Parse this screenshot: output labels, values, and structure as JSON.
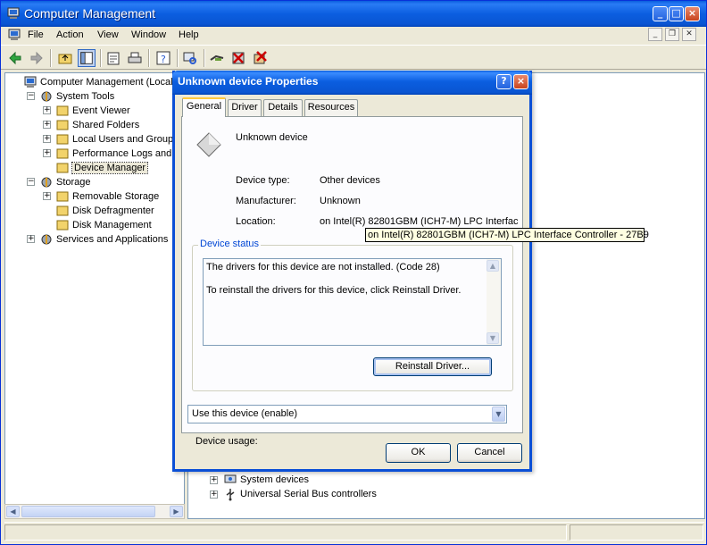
{
  "window": {
    "title": "Computer Management"
  },
  "menu": [
    "File",
    "Action",
    "View",
    "Window",
    "Help"
  ],
  "tree": {
    "items": [
      {
        "label": "Computer Management (Local)",
        "level": 0,
        "expander": ""
      },
      {
        "label": "System Tools",
        "level": 1,
        "expander": "-"
      },
      {
        "label": "Event Viewer",
        "level": 2,
        "expander": "+"
      },
      {
        "label": "Shared Folders",
        "level": 2,
        "expander": "+"
      },
      {
        "label": "Local Users and Groups",
        "level": 2,
        "expander": "+"
      },
      {
        "label": "Performance Logs and Alerts",
        "level": 2,
        "expander": "+"
      },
      {
        "label": "Device Manager",
        "level": 2,
        "expander": ""
      },
      {
        "label": "Storage",
        "level": 1,
        "expander": "-"
      },
      {
        "label": "Removable Storage",
        "level": 2,
        "expander": "+"
      },
      {
        "label": "Disk Defragmenter",
        "level": 2,
        "expander": ""
      },
      {
        "label": "Disk Management",
        "level": 2,
        "expander": ""
      },
      {
        "label": "Services and Applications",
        "level": 1,
        "expander": "+"
      }
    ]
  },
  "devices": [
    "System devices",
    "Universal Serial Bus controllers"
  ],
  "dialog": {
    "title": "Unknown device Properties",
    "tabs": [
      "General",
      "Driver",
      "Details",
      "Resources"
    ],
    "device_name": "Unknown device",
    "fields": {
      "type_label": "Device type:",
      "type_value": "Other devices",
      "manufacturer_label": "Manufacturer:",
      "manufacturer_value": "Unknown",
      "location_label": "Location:",
      "location_value": "on Intel(R) 82801GBM (ICH7-M) LPC Interfac"
    },
    "tooltip": "on Intel(R) 82801GBM (ICH7-M) LPC Interface Controller - 27B9",
    "status_group": "Device status",
    "status_line1": "The drivers for this device are not installed. (Code 28)",
    "status_line2": "To reinstall the drivers for this device, click Reinstall Driver.",
    "reinstall_button": "Reinstall Driver...",
    "usage_label": "Device usage:",
    "usage_value": "Use this device (enable)",
    "ok": "OK",
    "cancel": "Cancel"
  }
}
